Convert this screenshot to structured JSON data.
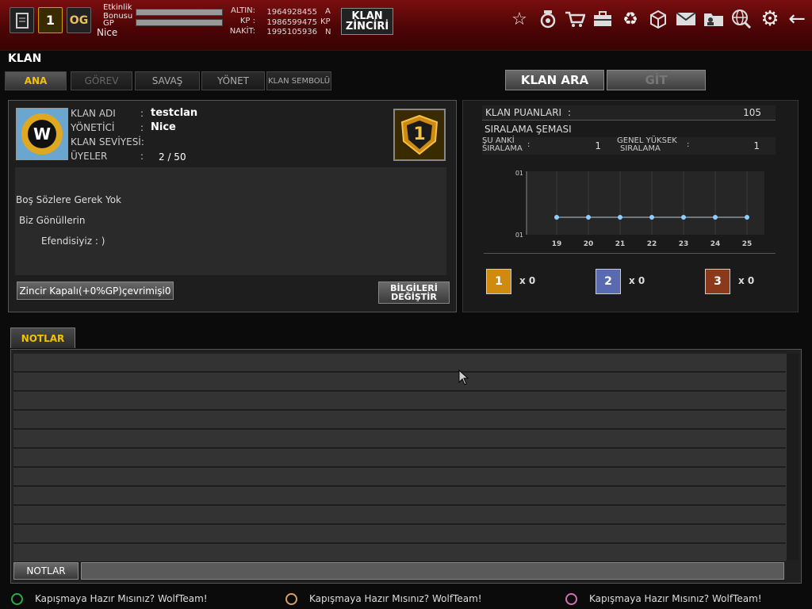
{
  "topbar": {
    "level_badge": "1",
    "og_label": "OG",
    "event_bonus_label": "Etkinlik\nBonusu",
    "gp_label": "GP",
    "player_name": "Nice",
    "money": [
      {
        "label": "ALTIN:",
        "value": "1964928455",
        "unit": "A"
      },
      {
        "label": "KP :",
        "value": "1986599475",
        "unit": "KP"
      },
      {
        "label": "NAKİT:",
        "value": "1995105936",
        "unit": "N"
      }
    ],
    "klan_zinciri_line1": "KLAN",
    "klan_zinciri_line2": "ZİNCİRİ",
    "right_icons": [
      "star-icon",
      "medal-icon",
      "cart-icon",
      "inventory-icon",
      "recycle-icon",
      "box-icon",
      "mail-icon",
      "folder-icon",
      "globe-icon",
      "settings-icon",
      "back-arrow-icon"
    ]
  },
  "page": {
    "title": "KLAN"
  },
  "tabs": [
    "ANA",
    "GÖREV",
    "SAVAŞ",
    "YÖNET",
    "KLAN SEMBOLÜ"
  ],
  "actions": {
    "search": "KLAN ARA",
    "go": "GİT"
  },
  "clan": {
    "labels": {
      "name": "KLAN ADI",
      "admin": "YÖNETİCİ",
      "level": "KLAN SEVİYESİ:",
      "members": "ÜYELER"
    },
    "colon": ":",
    "name": "testclan",
    "admin": "Nice",
    "level": "",
    "members": "2 / 50",
    "rank_badge": "1",
    "description": [
      "Boş Sözlere Gerek Yok",
      "Biz Gönüllerin",
      "Efendisiyiz : )"
    ],
    "chain_button": "Zincir Kapalı(+0%GP)çevrimişi0",
    "edit_button_line1": "BİLGİLERİ",
    "edit_button_line2": "DEĞİŞTİR"
  },
  "stats": {
    "points_label": "KLAN PUANLARI",
    "points_colon": ":",
    "points_value": "105",
    "ranking_title": "SIRALAMA ŞEMASI",
    "current_label_1": "ŞU ANKİ",
    "current_label_2": "SIRALAMA",
    "current_colon": ":",
    "current_value": "1",
    "highest_label_1": "GENEL YÜKSEK",
    "highest_label_2": "SIRALAMA",
    "highest_colon": ":",
    "highest_value": "1",
    "medals": [
      {
        "badge": "1",
        "count": "x 0",
        "color": "#d08a10"
      },
      {
        "badge": "2",
        "count": "x 0",
        "color": "#5a6ab0"
      },
      {
        "badge": "3",
        "count": "x 0",
        "color": "#8a3a1a"
      }
    ]
  },
  "chart_data": {
    "type": "line",
    "x": [
      "19",
      "20",
      "21",
      "22",
      "23",
      "24",
      "25"
    ],
    "series": [
      {
        "values": [
          1,
          1,
          1,
          1,
          1,
          1,
          1
        ]
      }
    ],
    "ytick_labels": [
      "01",
      "01"
    ],
    "title": "",
    "xlabel": "",
    "ylabel": ""
  },
  "notes": {
    "tab_label": "NOTLAR",
    "button_label": "NOTLAR",
    "input_value": ""
  },
  "ticker": [
    {
      "text": "Kapışmaya Hazır Mısınız? WolfTeam!",
      "color": "#2fa84a"
    },
    {
      "text": "Kapışmaya Hazır Mısınız? WolfTeam!",
      "color": "#d8a060"
    },
    {
      "text": "Kapışmaya Hazır Mısınız? WolfTeam!",
      "color": "#d070b0"
    }
  ]
}
